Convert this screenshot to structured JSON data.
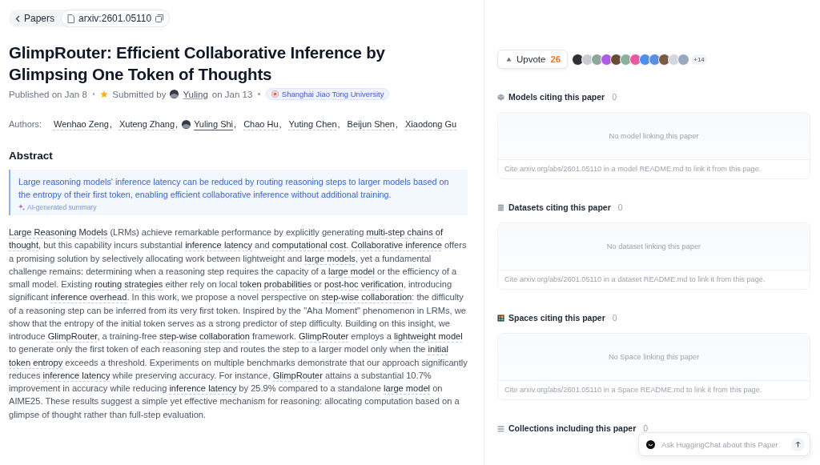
{
  "breadcrumb": {
    "back": "Papers",
    "paper_id": "arxiv:2601.05110"
  },
  "title": "GlimpRouter: Efficient Collaborative Inference by Glimpsing One Token of Thoughts",
  "meta": {
    "published": "Published on Jan 8",
    "submitted_prefix": "Submitted by",
    "submitter": "Yuling",
    "submitted_date": "on Jan 13",
    "organization": "Shanghai Jiao Tong University"
  },
  "authors_label": "Authors:",
  "authors_separator": ",",
  "authors": [
    {
      "name": "Wenhao Zeng",
      "kind": "plain"
    },
    {
      "name": "Xuteng Zhang",
      "kind": "plain"
    },
    {
      "name": "Yuling Shi",
      "kind": "user"
    },
    {
      "name": "Chao Hu",
      "kind": "plain"
    },
    {
      "name": "Yuting Chen",
      "kind": "plain"
    },
    {
      "name": "Beijun Shen",
      "kind": "plain"
    },
    {
      "name": "Xiaodong Gu",
      "kind": "plain"
    }
  ],
  "abstract_heading": "Abstract",
  "summary": {
    "text": "Large reasoning models' inference latency can be reduced by routing reasoning steps to larger models based on the entropy of their first token, enabling efficient collaborative inference without additional training.",
    "label": "AI-generated summary"
  },
  "abstract": "**Large Reasoning Models** (LRMs) achieve remarkable performance by explicitly generating **multi-step chains of thought**, but this capability incurs substantial **inference latency** and **computational cost**. **Collaborative inference** offers a promising solution by selectively allocating work between lightweight and **large models**, yet a fundamental challenge remains: determining when a reasoning step requires the capacity of a **large model** or the efficiency of a small model. Existing **routing strategies** either rely on local **token probabilities** or **post-hoc verification**, introducing significant **inference overhead**. In this work, we propose a novel perspective on **step-wise collaboration**: the difficulty of a reasoning step can be inferred from its very first token. Inspired by the \"Aha Moment\" phenomenon in LRMs, we show that the entropy of the initial token serves as a strong predictor of step difficulty. Building on this insight, we introduce **GlimpRouter**, a training-free **step-wise collaboration** framework. **GlimpRouter** employs a **lightweight model** to generate only the first token of each reasoning step and routes the step to a larger model only when the **initial token entropy** exceeds a threshold. Experiments on multiple benchmarks demonstrate that our approach significantly reduces **inference latency** while preserving accuracy. For instance, **GlimpRouter** attains a substantial 10.7% improvement in accuracy while reducing **inference latency** by 25.9% compared to a standalone **large model** on AIME25. These results suggest a simple yet effective mechanism for reasoning: allocating computation based on a glimpse of thought rather than full-step evaluation.",
  "upvote": {
    "label": "Upvote",
    "count": "26",
    "more": "+14",
    "avatars": [
      {
        "color": "#2f2f35"
      },
      {
        "color": "#c9ccd3"
      },
      {
        "color": "#8fa79a"
      },
      {
        "color": "#b05be0"
      },
      {
        "color": "#6b4a35"
      },
      {
        "color": "#8ab0a0"
      },
      {
        "color": "#e85aa0"
      },
      {
        "color": "#4d8df0"
      },
      {
        "color": "#5a8fe8"
      },
      {
        "color": "#7a5c44"
      },
      {
        "color": "#d5d7dc"
      },
      {
        "color": "#9aa7c0"
      }
    ]
  },
  "sections": [
    {
      "kind": "models",
      "title": "Models citing this paper",
      "count": "0",
      "empty": "No model linking this paper",
      "hint": "Cite arxiv.org/abs/2601.05110 in a model README.md to link it from this page."
    },
    {
      "kind": "datasets",
      "title": "Datasets citing this paper",
      "count": "0",
      "empty": "No dataset linking this paper",
      "hint": "Cite arxiv.org/abs/2601.05110 in a dataset README.md to link it from this page."
    },
    {
      "kind": "spaces",
      "title": "Spaces citing this paper",
      "count": "0",
      "empty": "No Space linking this paper",
      "hint": "Cite arxiv.org/abs/2601.05110 in a Space README.md to link it from this page."
    },
    {
      "kind": "collections",
      "title": "Collections including this paper",
      "count": "0"
    }
  ],
  "chat": {
    "placeholder": "Ask HuggingChat about this Paper"
  }
}
